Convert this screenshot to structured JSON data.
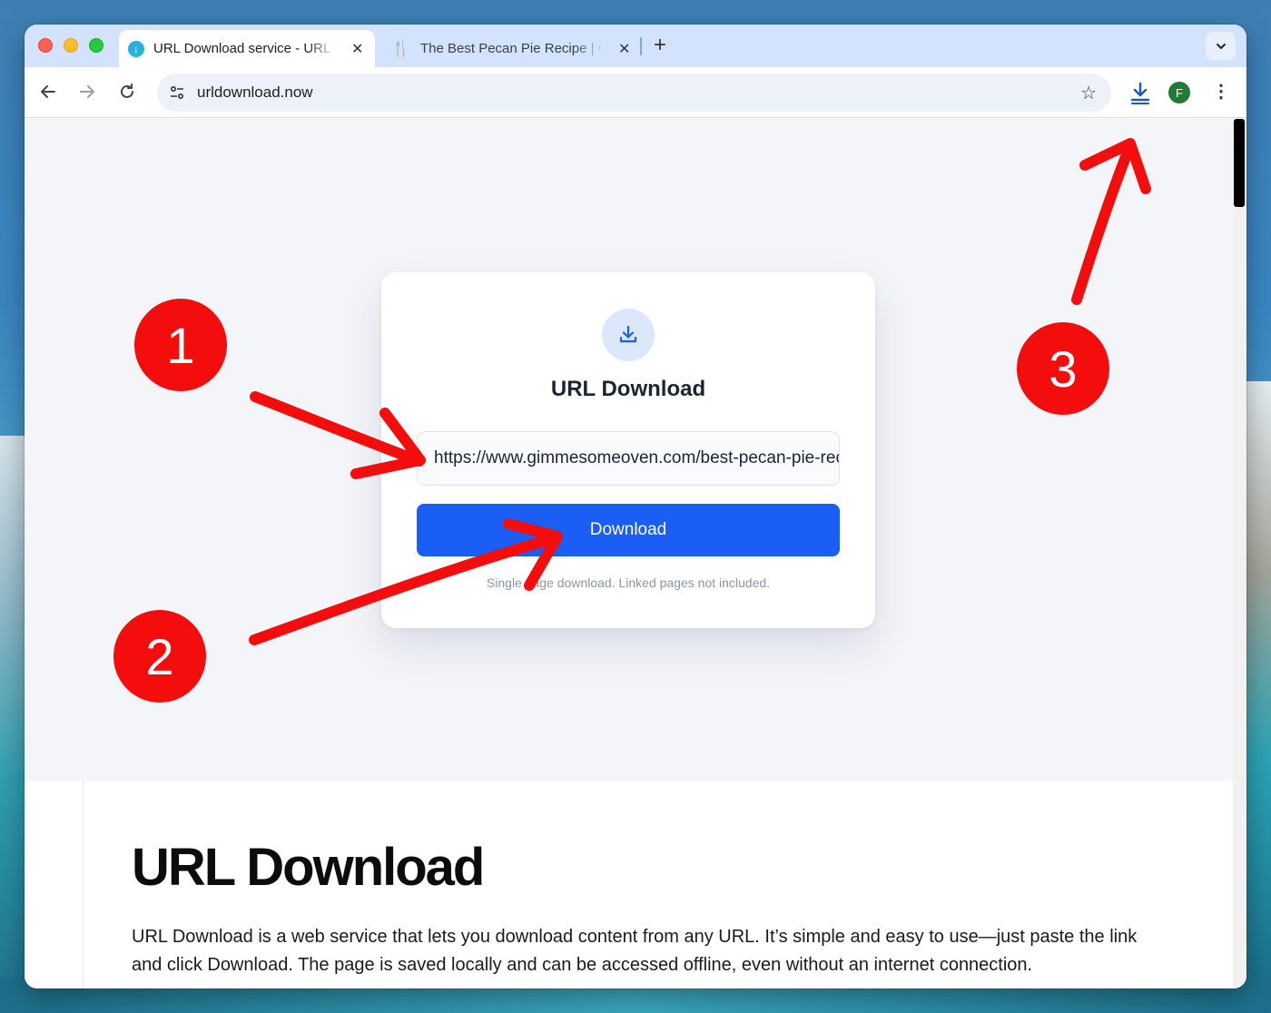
{
  "browser": {
    "tabs": [
      {
        "title": "URL Download service - URL Download",
        "close": "✕",
        "active": true
      },
      {
        "title": "The Best Pecan Pie Recipe | Gimme Some Oven",
        "close": "✕",
        "active": false
      }
    ],
    "new_tab": "+",
    "tab_menu": "⌄",
    "address": "urldownload.now",
    "profile_initial": "F",
    "toolbar_icons": [
      "back-arrow-icon",
      "forward-arrow-icon",
      "reload-icon",
      "site-settings-icon",
      "bookmark-star-icon",
      "download-icon",
      "more-vert-icon"
    ]
  },
  "card": {
    "title": "URL Download",
    "url_value": "https://www.gimmesomeoven.com/best-pecan-pie-recipe/",
    "button": "Download",
    "note": "Single page download. Linked pages not included."
  },
  "article": {
    "heading": "URL Download",
    "body": "URL Download is a web service that lets you download content from any URL. It’s simple and easy to use—just paste the link and click Download. The page is saved locally and can be accessed offline, even without an internet connection."
  },
  "annotations": {
    "badges": [
      "1",
      "2",
      "3"
    ],
    "color": "#f40d0d"
  },
  "colors": {
    "accent_button": "#1a5ef5",
    "tab_strip": "#d3e3fd",
    "hero_bg": "#f3f5f9",
    "avatar": "#1e7d32"
  }
}
